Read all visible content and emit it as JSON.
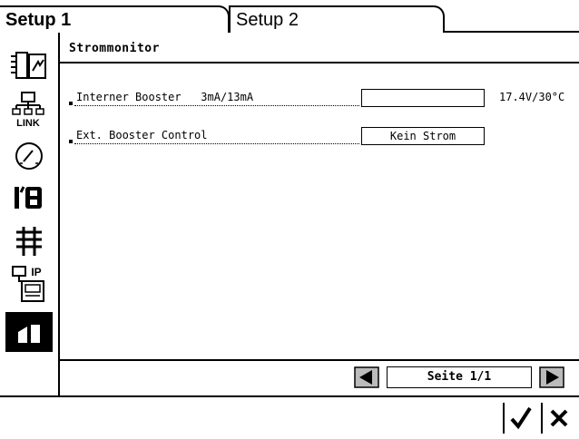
{
  "tabs": [
    {
      "label": "Setup 1",
      "active": true
    },
    {
      "label": "Setup 2",
      "active": false
    }
  ],
  "sidebar": {
    "icons": [
      "booster-icon",
      "link-icon",
      "gauge-icon",
      "io-icon",
      "track-icon",
      "ip-network-icon",
      "stats-icon"
    ],
    "active_index": 6
  },
  "section": {
    "title": "Strommonitor"
  },
  "rows": [
    {
      "label": "Interner Booster   3mA/13mA",
      "field_value": "",
      "readout": "17.4V/30°C"
    },
    {
      "label": "Ext. Booster Control",
      "field_value": "Kein Strom",
      "readout": ""
    }
  ],
  "pager": {
    "label": "Seite 1/1"
  },
  "actions": {
    "confirm": "check-icon",
    "cancel": "close-icon"
  }
}
